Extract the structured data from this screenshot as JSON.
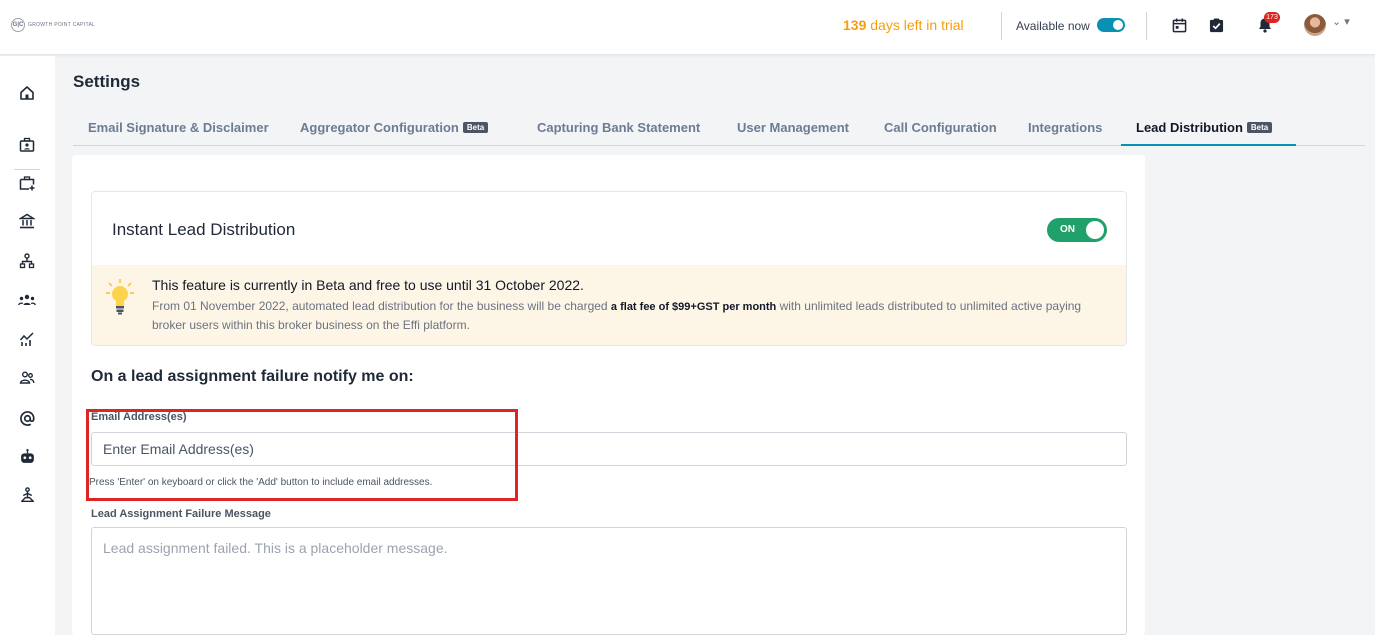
{
  "header": {
    "logo_text": "GROWTH POINT CAPITAL",
    "logo_mark": "G|C",
    "trial_days": "139",
    "trial_text": " days left in trial",
    "availability_label": "Available now",
    "notification_count": "173"
  },
  "sidebar": {
    "icons": [
      "home-icon",
      "briefcase-user-icon",
      "briefcase-add-icon",
      "bank-icon",
      "org-chart-icon",
      "team-icon",
      "analytics-icon",
      "users-icon",
      "at-sign-icon",
      "robot-icon",
      "meditation-icon"
    ]
  },
  "page": {
    "title": "Settings"
  },
  "tabs": [
    {
      "label": "Email Signature & Disclaimer",
      "badge": ""
    },
    {
      "label": "Aggregator Configuration",
      "badge": "Beta"
    },
    {
      "label": "Capturing Bank Statement",
      "badge": ""
    },
    {
      "label": "User Management",
      "badge": ""
    },
    {
      "label": "Call Configuration",
      "badge": ""
    },
    {
      "label": "Integrations",
      "badge": ""
    },
    {
      "label": "Lead Distribution",
      "badge": "Beta"
    }
  ],
  "feature": {
    "title": "Instant Lead Distribution",
    "toggle_label": "ON",
    "beta_heading": "This feature is currently in Beta and free to use until 31 October 2022.",
    "beta_body_before": "From 01 November 2022, automated lead distribution for the business will be charged ",
    "beta_body_bold": "a flat fee of $99+GST per month",
    "beta_body_after": " with unlimited leads distributed to unlimited active paying broker users within this broker business on the Effi platform."
  },
  "notify": {
    "section_title": "On a lead assignment failure notify me on:",
    "email_label": "Email Address(es)",
    "email_placeholder": "Enter Email Address(es)",
    "email_value": "",
    "help_text": "Press 'Enter' on keyboard or click the 'Add' button to include email addresses.",
    "message_label": "Lead Assignment Failure Message",
    "message_placeholder": "Lead assignment failed. This is a placeholder message."
  },
  "colors": {
    "accent": "#0891b2",
    "toggle_on": "#22a06b",
    "trial": "#f59e0b",
    "beta_bg": "#fdf6e7",
    "highlight": "#dc2626"
  }
}
